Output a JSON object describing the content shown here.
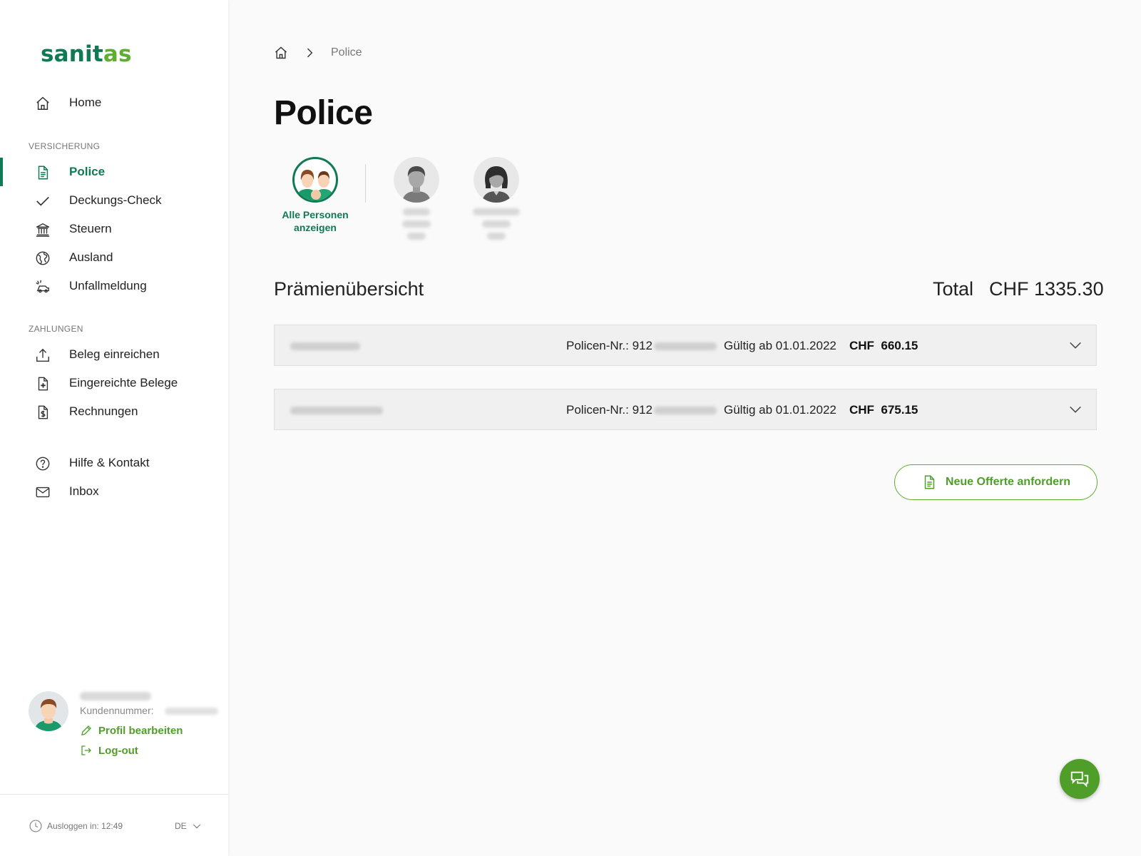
{
  "app": {
    "logo_main": "sanit",
    "logo_accent": "as"
  },
  "sidebar": {
    "nav_home": "Home",
    "section_versicherung": "VERSICHERUNG",
    "items_versicherung": [
      {
        "label": "Police",
        "icon": "document-icon",
        "active": true
      },
      {
        "label": "Deckungs-Check",
        "icon": "check-icon"
      },
      {
        "label": "Steuern",
        "icon": "bank-icon"
      },
      {
        "label": "Ausland",
        "icon": "globe-icon"
      },
      {
        "label": "Unfallmeldung",
        "icon": "accident-icon"
      }
    ],
    "section_zahlungen": "ZAHLUNGEN",
    "items_zahlungen": [
      {
        "label": "Beleg einreichen",
        "icon": "upload-icon"
      },
      {
        "label": "Eingereichte Belege",
        "icon": "document-plus-icon"
      },
      {
        "label": "Rechnungen",
        "icon": "invoice-icon"
      }
    ],
    "items_misc": [
      {
        "label": "Hilfe & Kontakt",
        "icon": "help-icon"
      },
      {
        "label": "Inbox",
        "icon": "mail-icon"
      }
    ],
    "profile": {
      "customer_number_label": "Kundennummer:",
      "edit_profile": "Profil bearbeiten",
      "logout": "Log-out"
    },
    "footer": {
      "logout_timer": "Ausloggen in: 12:49",
      "language": "DE"
    }
  },
  "breadcrumb": {
    "current": "Police"
  },
  "page": {
    "title": "Police"
  },
  "persons": {
    "all_label": "Alle Personen anzeigen"
  },
  "premium": {
    "title": "Prämienübersicht",
    "total_label": "Total",
    "total_value": "CHF 1335.30",
    "rows": [
      {
        "policy_prefix": "Policen-Nr.: 912",
        "valid": "Gültig ab 01.01.2022",
        "amount": "CHF  660.15"
      },
      {
        "policy_prefix": "Policen-Nr.: 912",
        "valid": "Gültig ab 01.01.2022",
        "amount": "CHF  675.15"
      }
    ]
  },
  "actions": {
    "new_offer": "Neue Offerte anfordern"
  },
  "colors": {
    "brand_green": "#0f7a54",
    "accent_green": "#5fad32"
  }
}
